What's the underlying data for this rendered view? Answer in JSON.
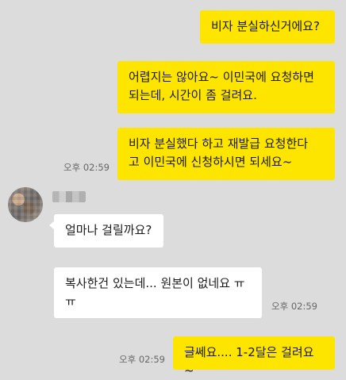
{
  "chat": {
    "messages": [
      {
        "sender": "me",
        "text": "비자 분실하신거에요?"
      },
      {
        "sender": "me",
        "text": "어렵지는 않아요~ 이민국에 요청하면\n되는데, 시간이 좀 걸려요."
      },
      {
        "sender": "me",
        "text": "비자 분실했다 하고 재발급 요청한다\n고 이민국에 신청하시면 되세요~",
        "time": "오후 02:59"
      },
      {
        "sender": "other",
        "text": "얼마나 걸릴까요?"
      },
      {
        "sender": "other",
        "text": "복사한건 있는데... 원본이 없네요 ㅠ\nㅠ",
        "time": "오후 02:59"
      },
      {
        "sender": "me",
        "text": "글쎄요.... 1-2달은 걸려요~",
        "time": "오후 02:59"
      }
    ],
    "other_user": {
      "name": "■■·■"
    }
  },
  "colors": {
    "background": "#dcdcdc",
    "my_bubble": "#fee500",
    "other_bubble": "#ffffff"
  }
}
